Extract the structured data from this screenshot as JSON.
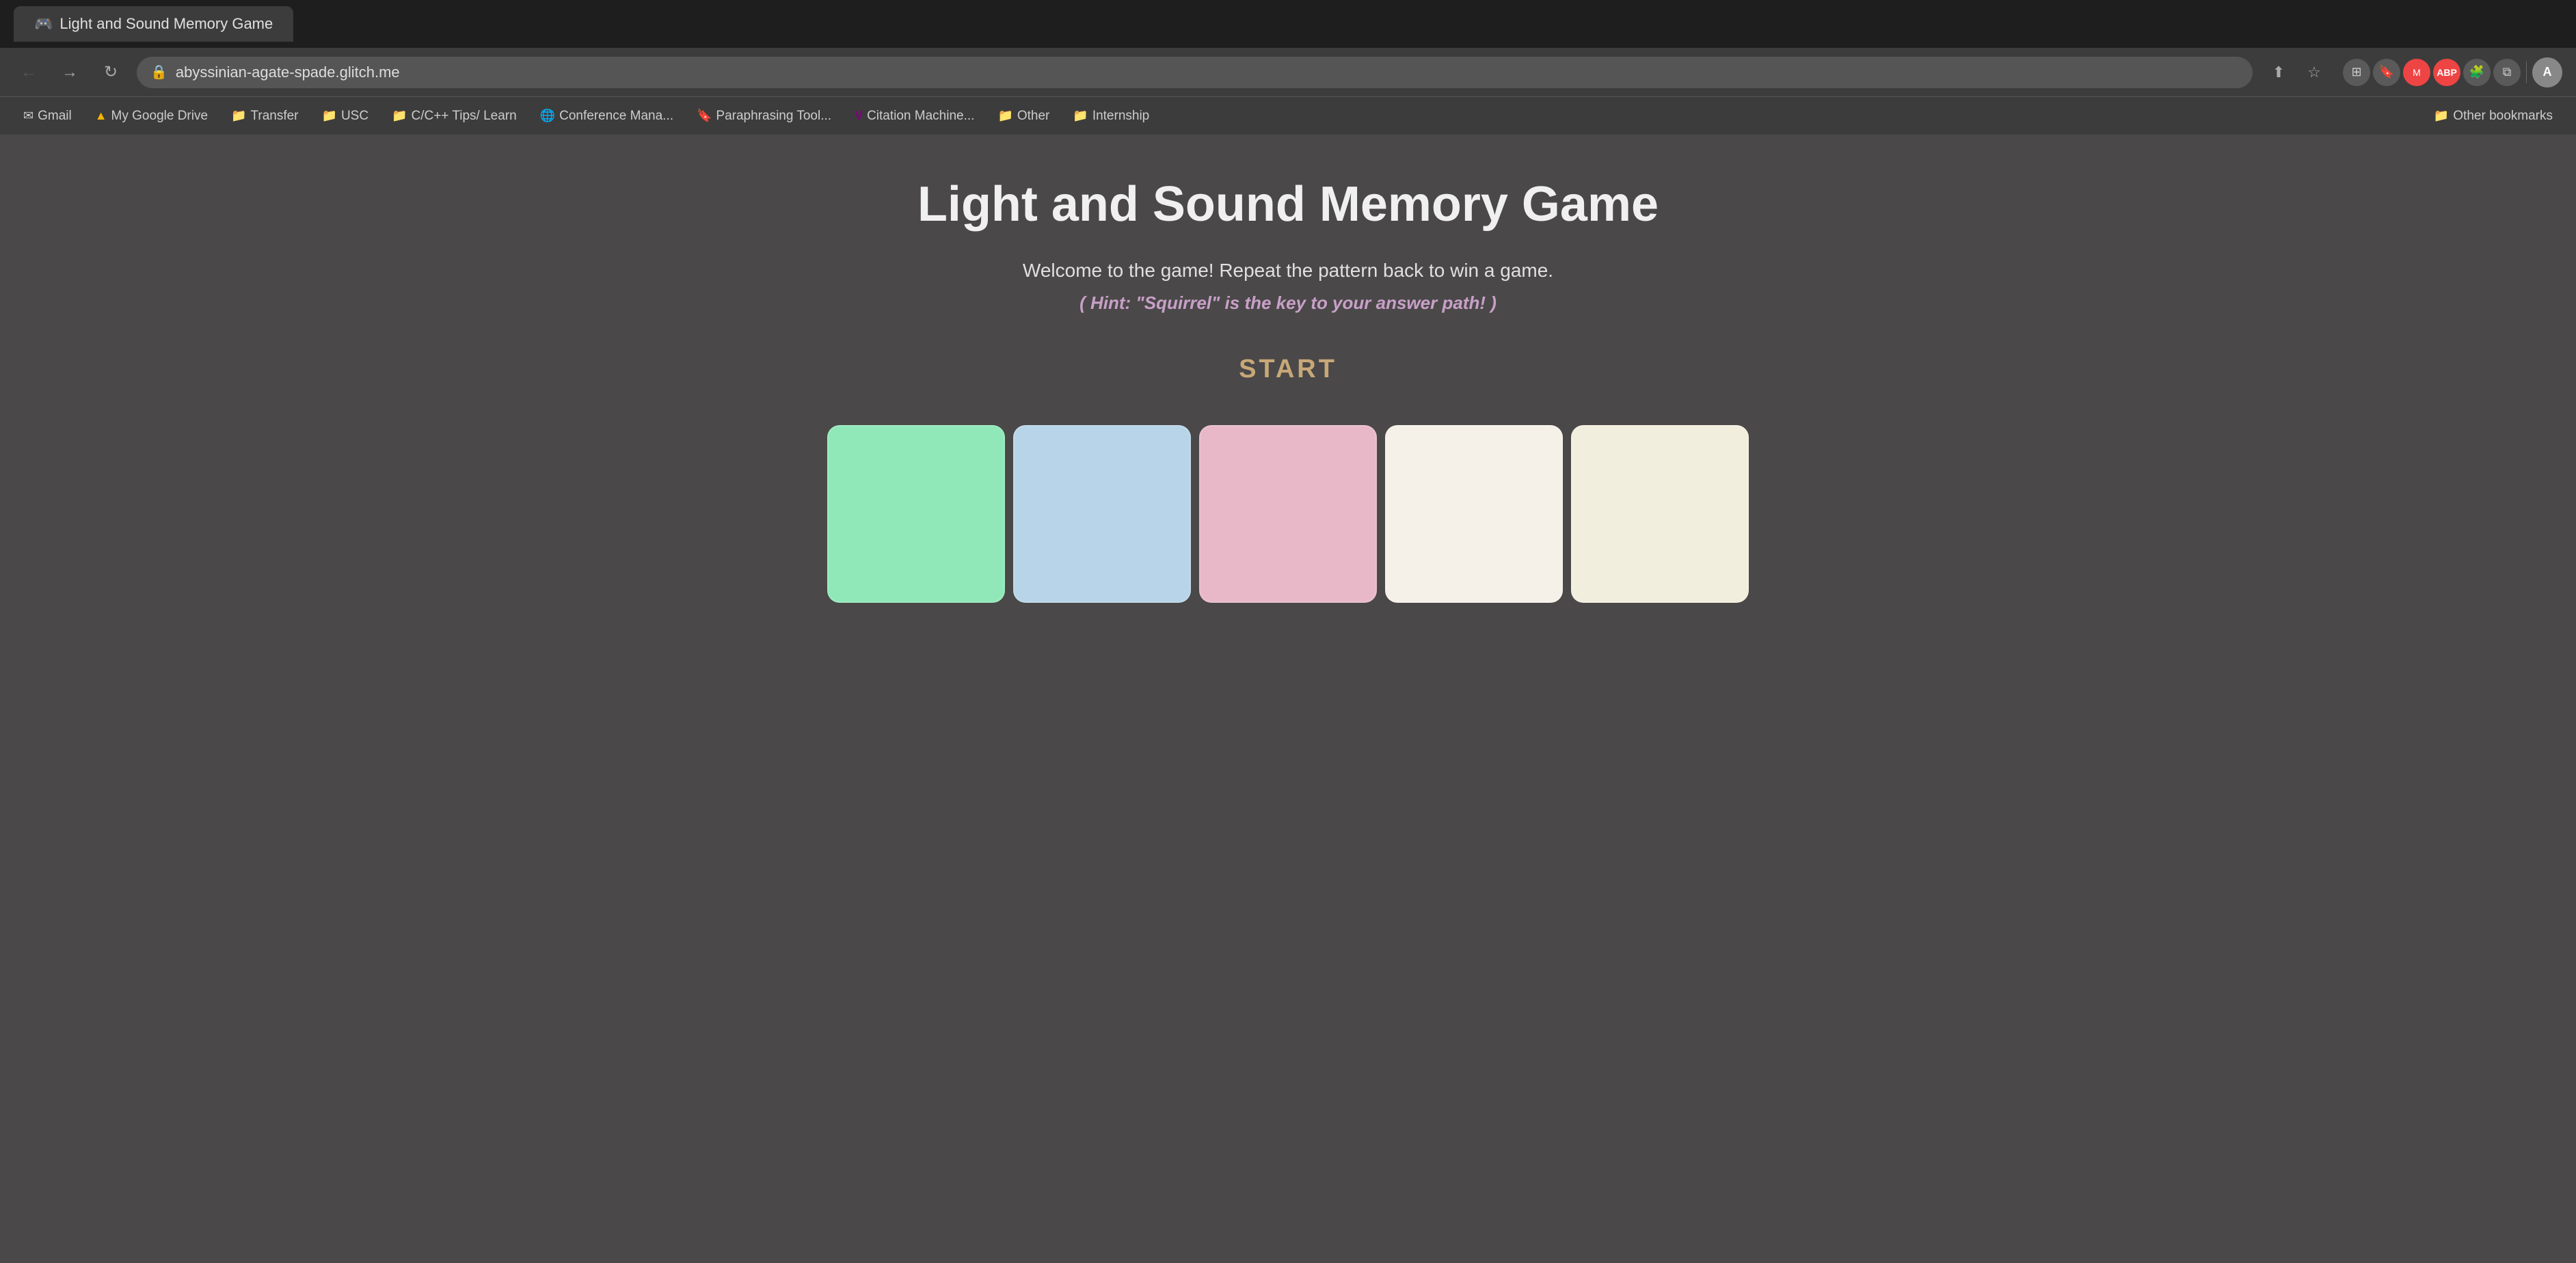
{
  "browser": {
    "tab_label": "Light and Sound Memory Game",
    "url": "abyssinian-agate-spade.glitch.me",
    "back_btn": "←",
    "forward_btn": "→",
    "reload_btn": "↻"
  },
  "bookmarks": [
    {
      "id": "gmail",
      "label": "Gmail",
      "icon": "✉"
    },
    {
      "id": "google-drive",
      "label": "My Google Drive",
      "icon": "▲"
    },
    {
      "id": "transfer",
      "label": "Transfer",
      "icon": "📁"
    },
    {
      "id": "usc",
      "label": "USC",
      "icon": "📁"
    },
    {
      "id": "cpp-tips",
      "label": "C/C++ Tips/ Learn",
      "icon": "📁"
    },
    {
      "id": "conference",
      "label": "Conference Mana...",
      "icon": "🌐"
    },
    {
      "id": "paraphrasing",
      "label": "Paraphrasing Tool...",
      "icon": "🔖"
    },
    {
      "id": "citation",
      "label": "Citation Machine...",
      "icon": "V"
    },
    {
      "id": "other",
      "label": "Other",
      "icon": "📁"
    },
    {
      "id": "internship",
      "label": "Internship",
      "icon": "📁"
    },
    {
      "id": "other-bookmarks",
      "label": "Other bookmarks",
      "icon": "📁"
    }
  ],
  "game": {
    "title": "Light and Sound Memory Game",
    "subtitle": "Welcome to the game!   Repeat the pattern back to win a game.",
    "hint": "( Hint: \"Squirrel\" is the key to your answer path! )",
    "start_label": "START",
    "pads": [
      {
        "id": "pad1",
        "color_name": "green",
        "color": "#90e8b8"
      },
      {
        "id": "pad2",
        "color_name": "blue",
        "color": "#b8d4e8"
      },
      {
        "id": "pad3",
        "color_name": "pink",
        "color": "#e8b8c8"
      },
      {
        "id": "pad4",
        "color_name": "cream1",
        "color": "#f5f0e8"
      },
      {
        "id": "pad5",
        "color_name": "cream2",
        "color": "#f2eedd"
      }
    ]
  }
}
